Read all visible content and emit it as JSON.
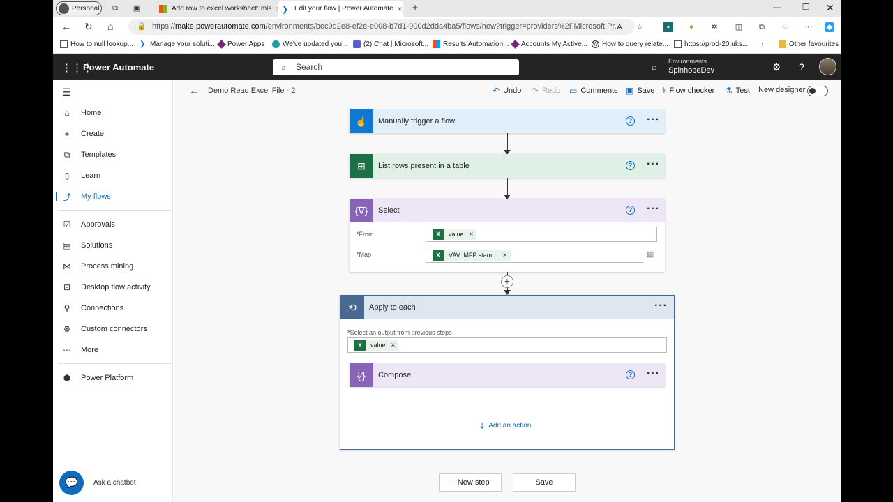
{
  "browser": {
    "profile": "Personal",
    "tabs": [
      {
        "title": "Add row to excel worksheet: mis",
        "active": false
      },
      {
        "title": "Edit your flow | Power Automate",
        "active": true
      }
    ],
    "url_prefix": "https://",
    "url_host": "make.powerautomate.com",
    "url_path": "/environments/bec9d2e8-ef2e-e008-b7d1-900d2dda4ba5/flows/new?trigger=providers%2FMicrosoft.Pr...",
    "favorites": [
      "How to null lookup...",
      "Manage your soluti...",
      "Power Apps",
      "We've updated you...",
      "(2) Chat | Microsoft...",
      "Results Automation...",
      "Accounts My Active...",
      "How to query relate...",
      "https://prod-20.uks..."
    ],
    "other_favourites": "Other favourites"
  },
  "app": {
    "name": "Power Automate",
    "search_placeholder": "Search",
    "env_label": "Environments",
    "env_name": "SpinhopeDev"
  },
  "nav": {
    "items": [
      "Home",
      "Create",
      "Templates",
      "Learn",
      "My flows",
      "Approvals",
      "Solutions",
      "Process mining",
      "Desktop flow activity",
      "Connections",
      "Custom connectors",
      "More",
      "Power Platform"
    ],
    "active": "My flows",
    "chatbot": "Ask a chatbot"
  },
  "commandbar": {
    "flow_title": "Demo Read Excel File - 2",
    "undo": "Undo",
    "redo": "Redo",
    "comments": "Comments",
    "save": "Save",
    "flow_checker": "Flow checker",
    "test": "Test",
    "new_designer": "New designer",
    "new_designer_on": false
  },
  "flow": {
    "trigger": {
      "title": "Manually trigger a flow",
      "color": "#0f78d4"
    },
    "list_rows": {
      "title": "List rows present in a table",
      "color": "#1d7044"
    },
    "select": {
      "title": "Select",
      "color": "#8764b8",
      "from_label": "From",
      "from_token": "value",
      "map_label": "Map",
      "map_token": "VAV: MFP stam..."
    },
    "apply_each": {
      "title": "Apply to each",
      "color": "#486991",
      "output_label": "Select an output from previous steps",
      "output_token": "value",
      "compose_title": "Compose",
      "add_action": "Add an action"
    },
    "new_step": "+ New step",
    "save": "Save"
  }
}
